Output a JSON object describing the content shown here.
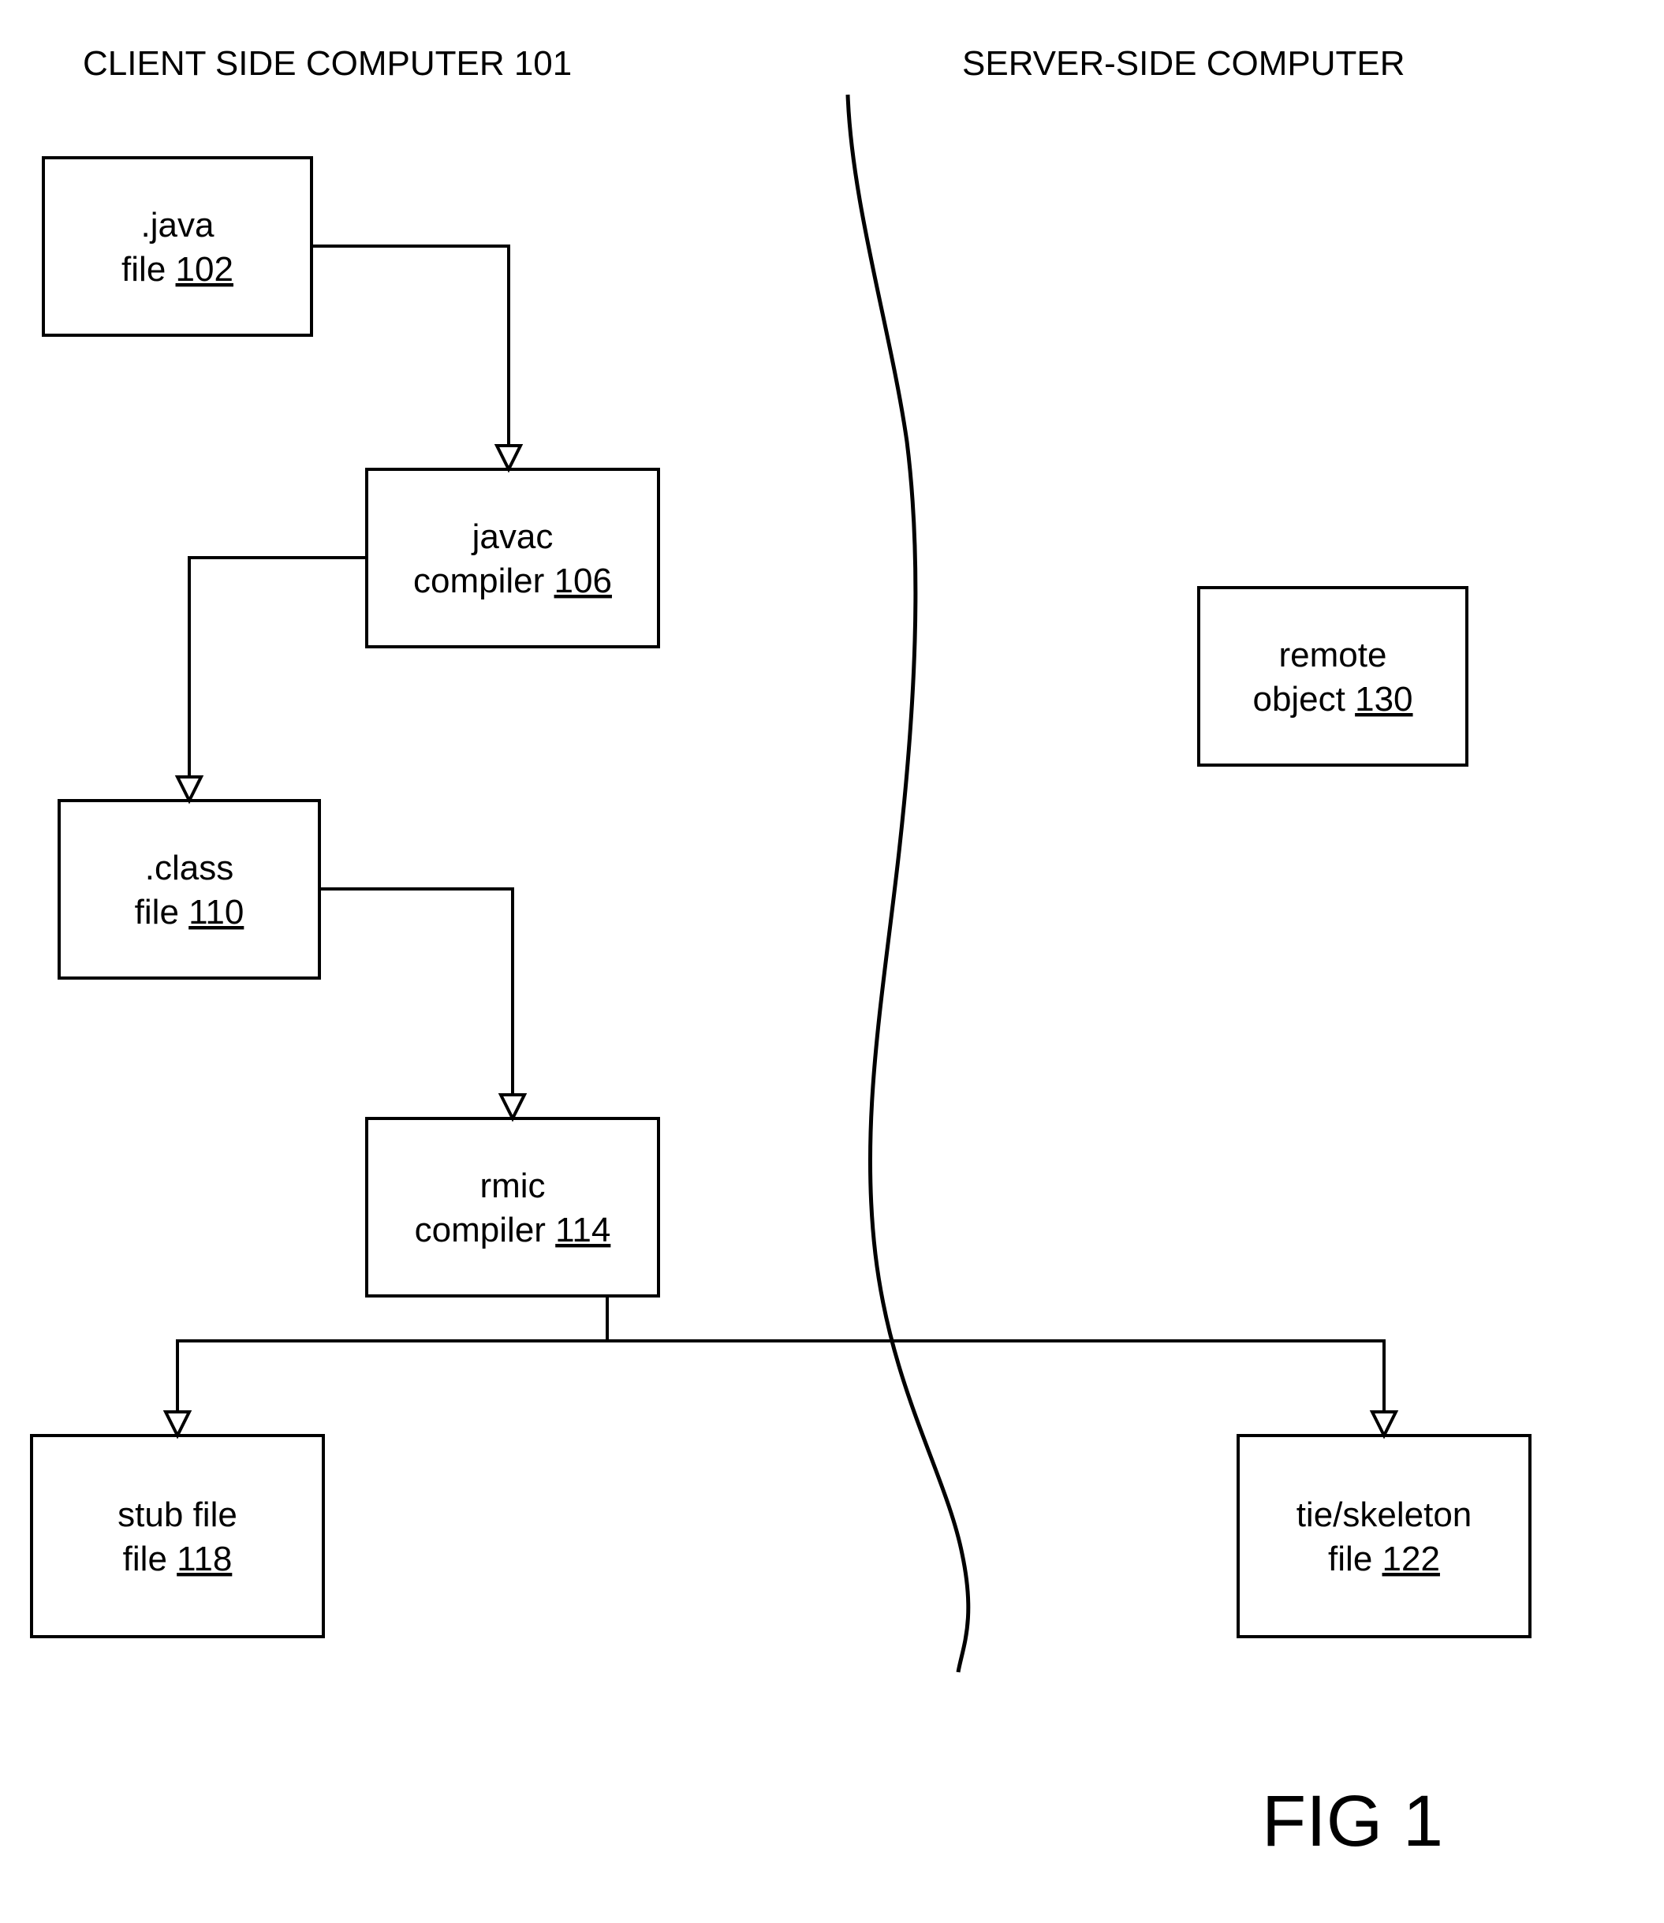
{
  "headers": {
    "left": "CLIENT SIDE COMPUTER 101",
    "right": "SERVER-SIDE COMPUTER"
  },
  "figure": "FIG 1",
  "boxes": {
    "javaFile": {
      "line1": ".java",
      "line2prefix": "file ",
      "line2ref": "102"
    },
    "javac": {
      "line1": "javac",
      "line2prefix": "compiler ",
      "line2ref": "106"
    },
    "classFile": {
      "line1": ".class",
      "line2prefix": "file ",
      "line2ref": "110"
    },
    "rmic": {
      "line1": "rmic",
      "line2prefix": "compiler ",
      "line2ref": "114"
    },
    "stubFile": {
      "line1": "stub file",
      "line2prefix": "file ",
      "line2ref": "118"
    },
    "remoteObj": {
      "line1": "remote",
      "line2prefix": "object ",
      "line2ref": "130"
    },
    "tieFile": {
      "line1": "tie/skeleton",
      "line2prefix": "file ",
      "line2ref": "122"
    }
  }
}
